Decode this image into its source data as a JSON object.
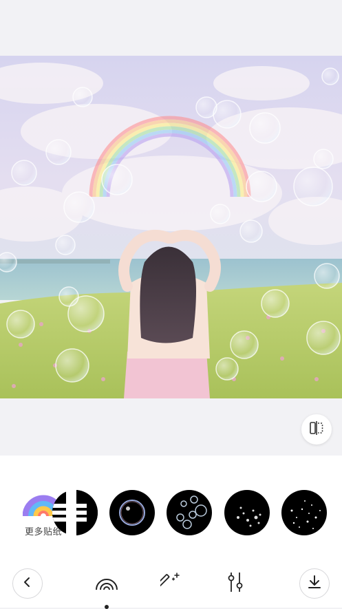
{
  "editor": {
    "photo": {
      "description_icon": "photo-with-rainbow-and-bubbles",
      "colors": {
        "sky": "#d8dbf0",
        "sea": "#8fb9c4",
        "grass": "#b8cc6a",
        "dress": "#f3c6d4"
      }
    },
    "compare_button": {
      "icon": "compare-split-icon"
    },
    "stickers": {
      "more": {
        "label": "更多贴纸",
        "icon": "rainbow-icon"
      },
      "items": [
        {
          "name": "piano-keys-sticker"
        },
        {
          "name": "single-bubble-sticker"
        },
        {
          "name": "bubble-cluster-sticker"
        },
        {
          "name": "small-bubbles-sticker"
        },
        {
          "name": "sparkle-bubbles-sticker"
        }
      ]
    },
    "toolbar": {
      "back": {
        "icon": "chevron-left-icon"
      },
      "tools": [
        {
          "name": "sticker-tool",
          "icon": "rainbow-arc-icon",
          "active": true
        },
        {
          "name": "magic-tool",
          "icon": "magic-wand-icon",
          "active": false
        },
        {
          "name": "adjust-tool",
          "icon": "sliders-icon",
          "active": false
        }
      ],
      "save": {
        "icon": "download-icon"
      }
    }
  }
}
